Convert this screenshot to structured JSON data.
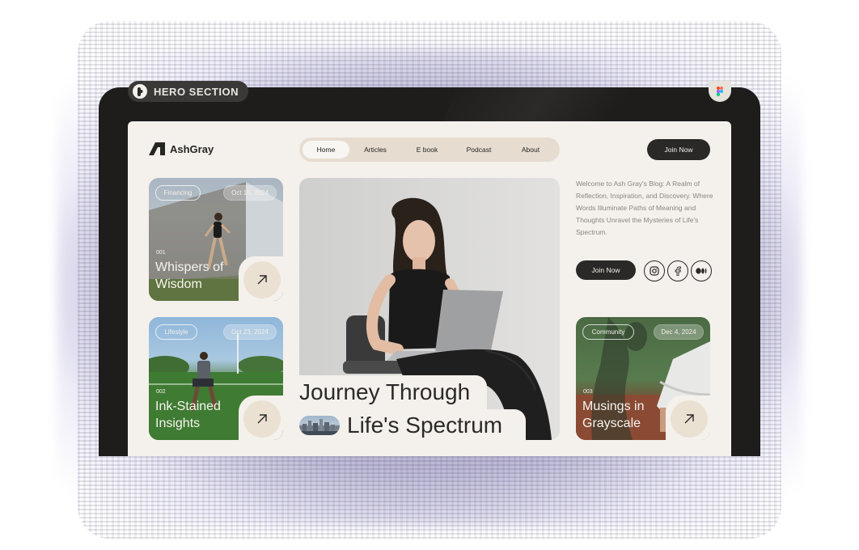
{
  "frame": {
    "label": "HERO SECTION",
    "figma_icon": "figma-icon"
  },
  "site": {
    "brand": "AshGray",
    "nav": [
      "Home",
      "Articles",
      "E book",
      "Podcast",
      "About"
    ],
    "active_nav": "Home",
    "join_label": "Join Now"
  },
  "cards": [
    {
      "tag": "Financing",
      "date": "Oct 16, 2024",
      "num": "001",
      "title_1": "Whispers of",
      "title_2": "Wisdom"
    },
    {
      "tag": "Lifestyle",
      "date": "Oct 23, 2024",
      "num": "002",
      "title_1": "Ink-Stained",
      "title_2": "Insights"
    },
    {
      "tag": "Community",
      "date": "Dec 4, 2024",
      "num": "003",
      "title_1": "Musings in",
      "title_2": "Grayscale"
    }
  ],
  "hero": {
    "headline_1": "Journey Through",
    "headline_2": "Life's Spectrum"
  },
  "intro": {
    "text": "Welcome to Ash Gray's Blog: A Realm of Reflection, Inspiration, and Discovery. Where Words Illuminate Paths of Meaning and Thoughts Unravel the Mysteries of Life's Spectrum.",
    "join_label": "Join Now"
  },
  "social": [
    "instagram-icon",
    "facebook-icon",
    "medium-icon"
  ],
  "colors": {
    "dark": "#2a2927",
    "paper": "#f4f1ec",
    "nav_bg": "#e6ddd0",
    "muted_text": "#8a857e"
  }
}
